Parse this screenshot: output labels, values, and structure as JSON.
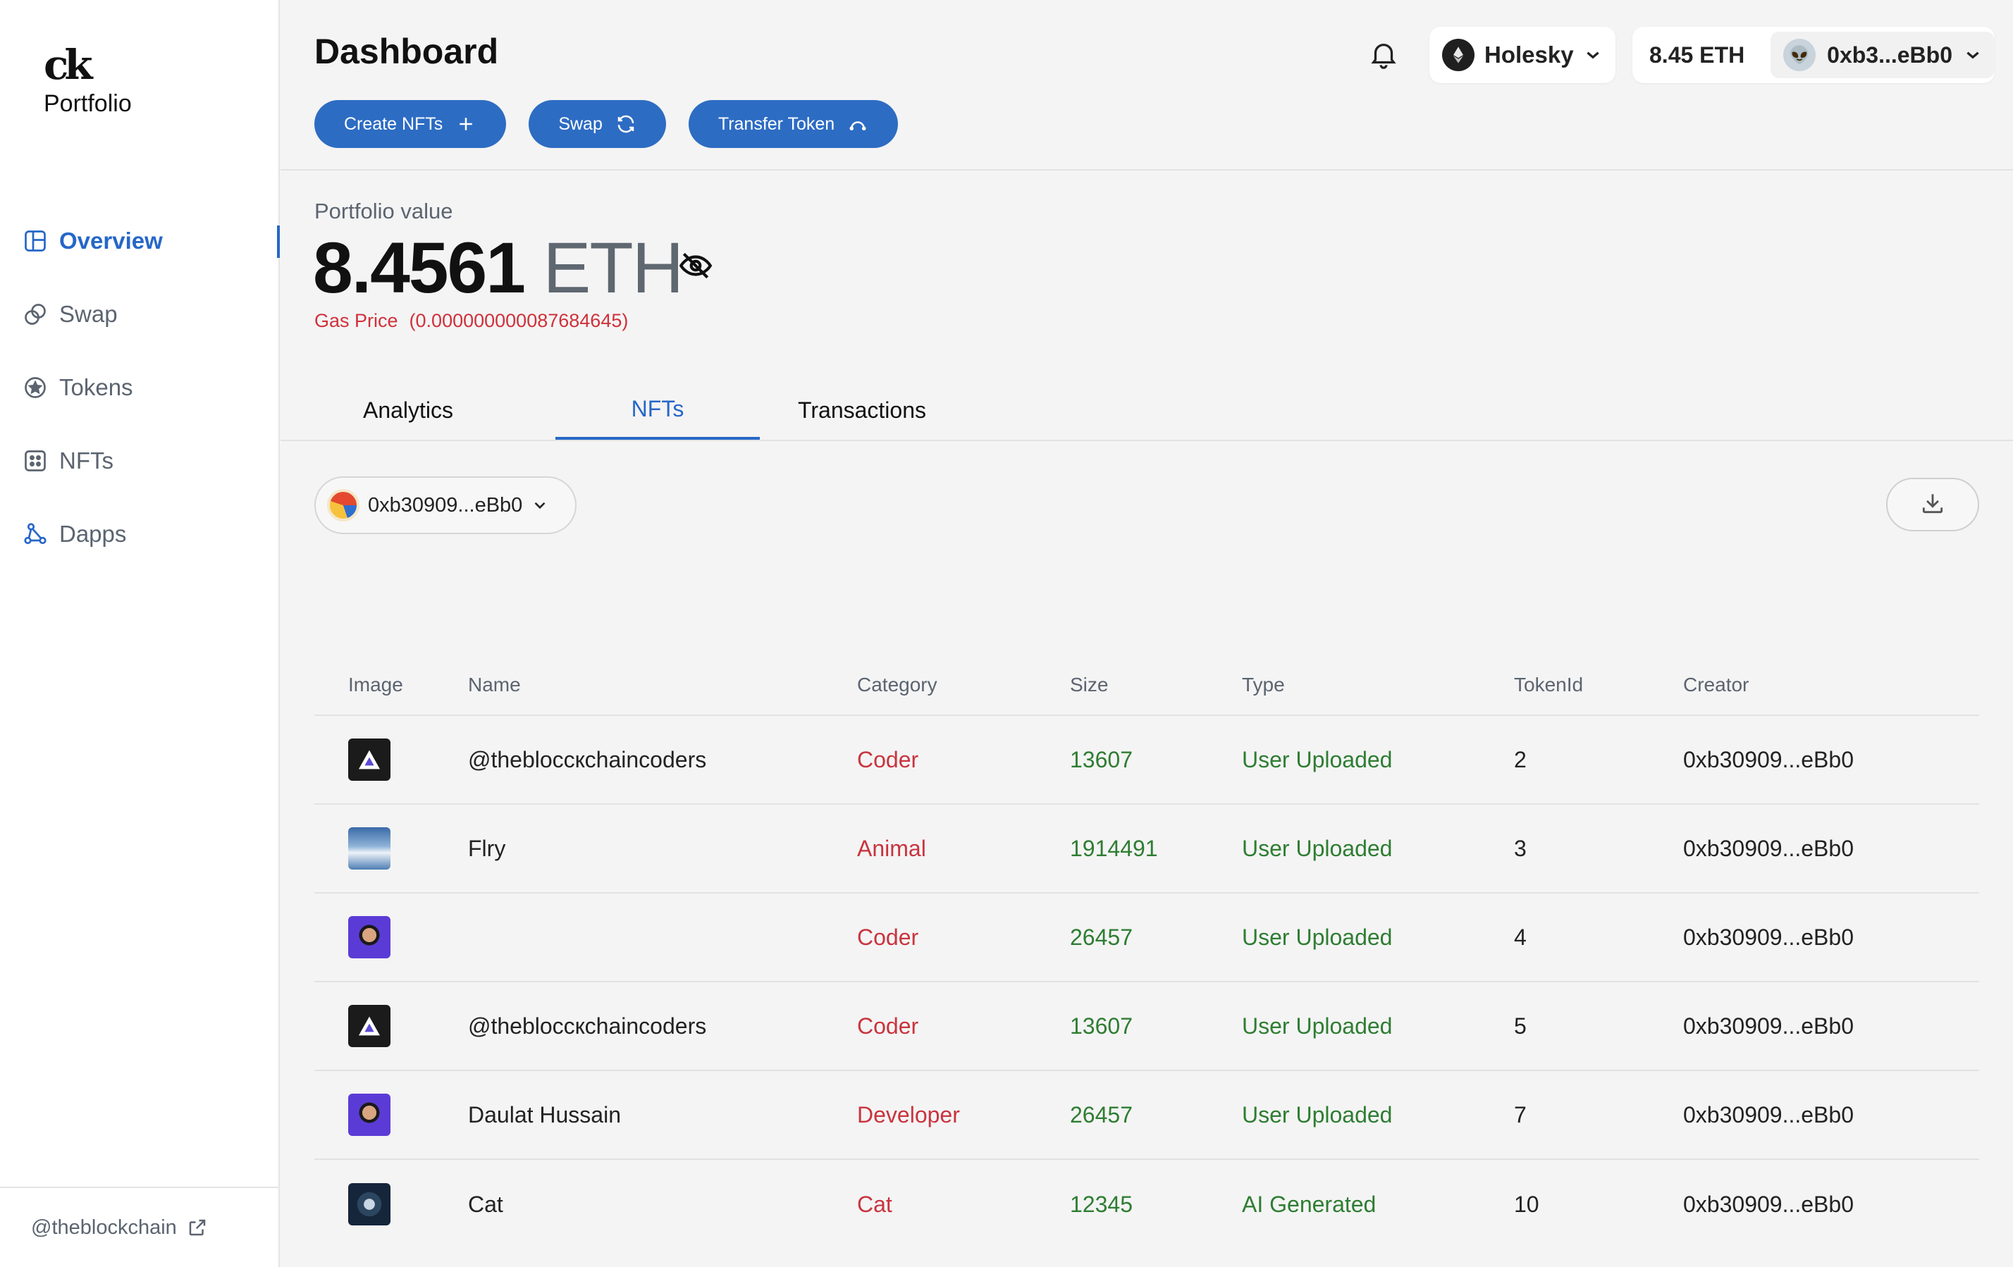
{
  "brand": {
    "mark": "ck",
    "name": "Portfolio"
  },
  "sidebar": {
    "items": [
      {
        "label": "Overview",
        "icon": "layout-icon",
        "active": true
      },
      {
        "label": "Swap",
        "icon": "swap-icon",
        "active": false
      },
      {
        "label": "Tokens",
        "icon": "star-circle-icon",
        "active": false
      },
      {
        "label": "NFTs",
        "icon": "grid-dots-icon",
        "active": false
      },
      {
        "label": "Dapps",
        "icon": "network-icon",
        "active": false
      }
    ],
    "footer_link": "@theblockchain"
  },
  "header": {
    "title": "Dashboard",
    "buttons": {
      "create_nfts": "Create NFTs",
      "swap": "Swap",
      "transfer_token": "Transfer Token"
    },
    "network": "Holesky",
    "wallet_balance": "8.45 ETH",
    "wallet_address": "0xb3...eBb0"
  },
  "portfolio": {
    "label": "Portfolio value",
    "value": "8.4561",
    "unit": "ETH",
    "gas_label": "Gas Price",
    "gas_value": "(0.000000000087684645)"
  },
  "tabs": [
    "Analytics",
    "NFTs",
    "Transactions"
  ],
  "active_tab": "NFTs",
  "filter": {
    "address": "0xb30909...eBb0"
  },
  "table": {
    "headers": [
      "Image",
      "Name",
      "Category",
      "Size",
      "Type",
      "TokenId",
      "Creator"
    ],
    "rows": [
      {
        "image": "coder-logo",
        "name": "@thebloccкchaincoders",
        "category": "Coder",
        "size": "13607",
        "type": "User Uploaded",
        "token_id": "2",
        "creator": "0xb30909...eBb0"
      },
      {
        "image": "mountain",
        "name": "Flry",
        "category": "Animal",
        "size": "1914491",
        "type": "User Uploaded",
        "token_id": "3",
        "creator": "0xb30909...eBb0"
      },
      {
        "image": "portrait",
        "name": "",
        "category": "Coder",
        "size": "26457",
        "type": "User Uploaded",
        "token_id": "4",
        "creator": "0xb30909...eBb0"
      },
      {
        "image": "coder-logo",
        "name": "@thebloccкchaincoders",
        "category": "Coder",
        "size": "13607",
        "type": "User Uploaded",
        "token_id": "5",
        "creator": "0xb30909...eBb0"
      },
      {
        "image": "portrait",
        "name": "Daulat Hussain",
        "category": "Developer",
        "size": "26457",
        "type": "User Uploaded",
        "token_id": "7",
        "creator": "0xb30909...eBb0"
      },
      {
        "image": "cat",
        "name": "Cat",
        "category": "Cat",
        "size": "12345",
        "type": "AI Generated",
        "token_id": "10",
        "creator": "0xb30909...eBb0"
      }
    ]
  },
  "colors": {
    "accent": "#2667c7",
    "button": "#2d6cc3",
    "category": "#c9343e",
    "value_green": "#2e7d32",
    "gas": "#d0313b"
  }
}
